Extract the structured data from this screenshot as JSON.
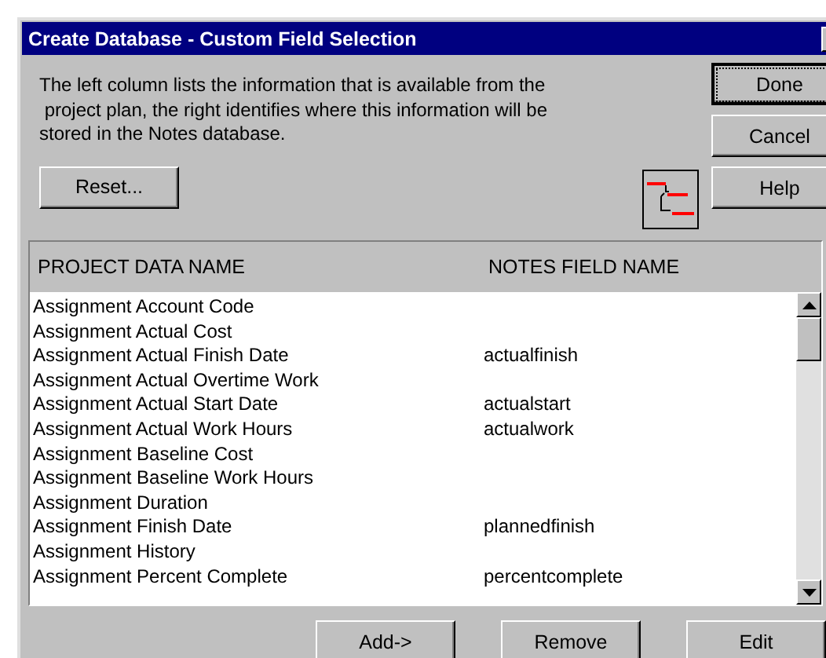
{
  "window": {
    "title": "Create Database - Custom Field Selection"
  },
  "description": "The left column lists the information that is available from the\n project plan, the right identifies where this information will be\nstored in the Notes database.",
  "side_buttons": [
    {
      "label": "Done",
      "default": true
    },
    {
      "label": "Cancel",
      "default": false
    },
    {
      "label": "Help",
      "default": false
    }
  ],
  "reset_button": "Reset...",
  "table": {
    "columns": [
      "PROJECT DATA NAME",
      "NOTES FIELD NAME"
    ],
    "rows": [
      [
        "Assignment Account Code",
        ""
      ],
      [
        "Assignment Actual Cost",
        ""
      ],
      [
        "Assignment Actual Finish Date",
        "actualfinish"
      ],
      [
        "Assignment Actual Overtime Work",
        ""
      ],
      [
        "Assignment Actual Start Date",
        "actualstart"
      ],
      [
        "Assignment Actual Work Hours",
        "actualwork"
      ],
      [
        "Assignment Baseline Cost",
        ""
      ],
      [
        "Assignment Baseline Work Hours",
        ""
      ],
      [
        "Assignment Duration",
        ""
      ],
      [
        "Assignment Finish Date",
        "plannedfinish"
      ],
      [
        "Assignment History",
        ""
      ],
      [
        "Assignment Percent Complete",
        "percentcomplete"
      ]
    ]
  },
  "bottom_buttons": [
    "Add->",
    "Remove",
    "Edit"
  ]
}
